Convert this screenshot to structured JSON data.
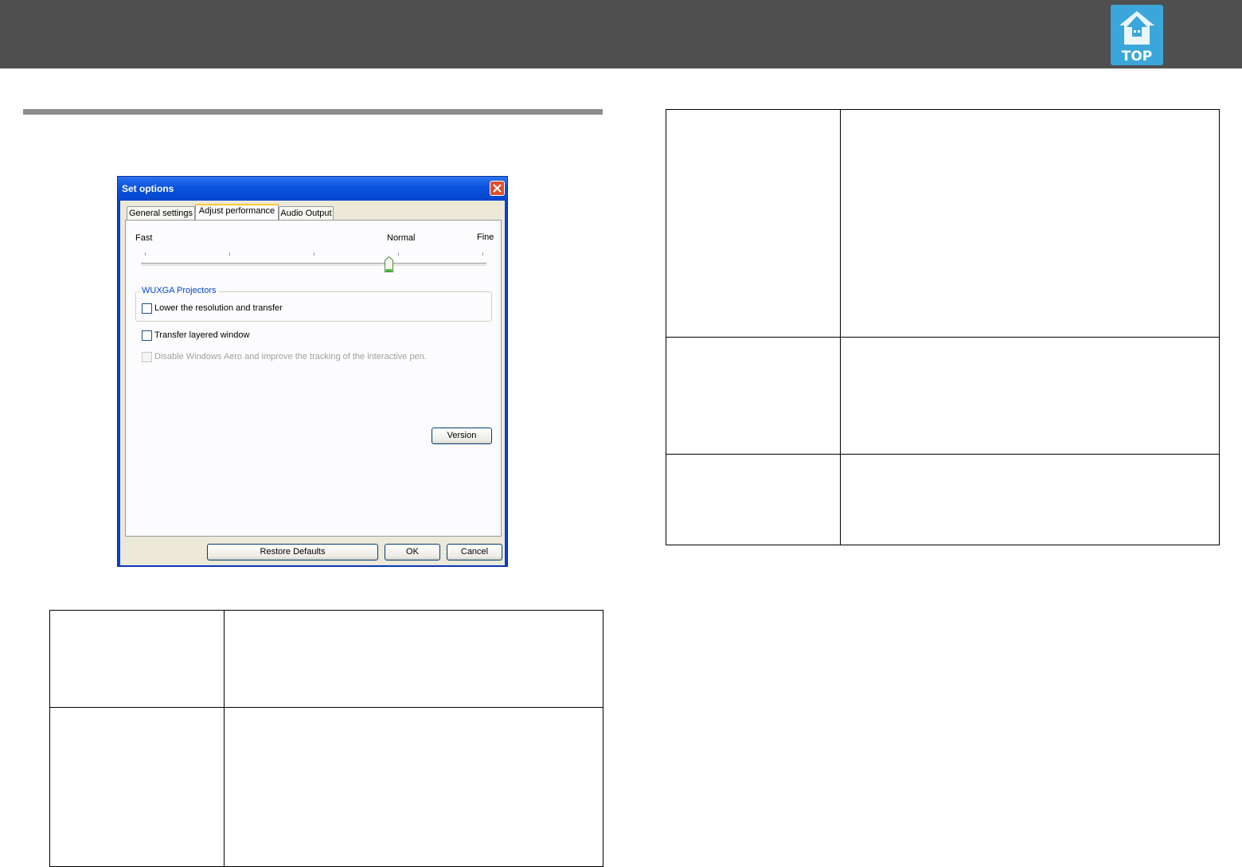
{
  "header": {
    "top_logo_label": "TOP",
    "top_logo_icon": "house-arrow-icon",
    "accent_color": "#3aa6d9",
    "bar_color": "#4f4f4f"
  },
  "dialog": {
    "title": "Set options",
    "tabs": [
      {
        "label": "General settings",
        "active": false
      },
      {
        "label": "Adjust performance",
        "active": true
      },
      {
        "label": "Audio Output",
        "active": false
      }
    ],
    "slider": {
      "label_fast": "Fast",
      "label_normal": "Normal",
      "label_fine": "Fine",
      "positions": 5,
      "selected_index": 3
    },
    "group_title": "WUXGA Projectors",
    "checkboxes": [
      {
        "label": "Lower the resolution and transfer",
        "checked": false,
        "enabled": true
      },
      {
        "label": "Transfer layered window",
        "checked": false,
        "enabled": true
      },
      {
        "label": "Disable Windows Aero and improve the tracking of the interactive pen.",
        "checked": false,
        "enabled": false
      }
    ],
    "buttons": {
      "version": "Version",
      "restore_defaults": "Restore Defaults",
      "ok": "OK",
      "cancel": "Cancel"
    }
  },
  "tables": {
    "left": {
      "rows": 2,
      "columns": 2
    },
    "right": {
      "rows": 3,
      "columns": 2
    }
  }
}
